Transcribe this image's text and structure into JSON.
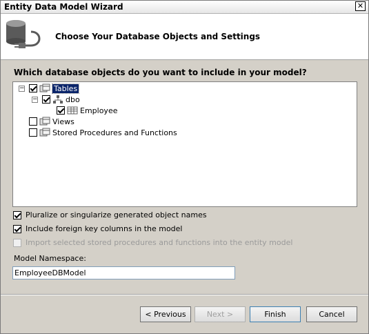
{
  "window": {
    "title": "Entity Data Model Wizard",
    "close_glyph": "✕"
  },
  "header": {
    "title": "Choose Your Database Objects and Settings"
  },
  "question": "Which database objects do you want to include in your model?",
  "tree": {
    "tables": {
      "label": "Tables",
      "checked": true,
      "expanded": true,
      "selected": true
    },
    "dbo": {
      "label": "dbo",
      "checked": true,
      "expanded": true
    },
    "employee": {
      "label": "Employee",
      "checked": true
    },
    "views": {
      "label": "Views",
      "checked": false
    },
    "procs": {
      "label": "Stored Procedures and Functions",
      "checked": false
    }
  },
  "options": {
    "pluralize": {
      "label": "Pluralize or singularize generated object names",
      "checked": true
    },
    "foreign_keys": {
      "label": "Include foreign key columns in the model",
      "checked": true
    },
    "import_procs": {
      "label": "Import selected stored procedures and functions into the entity model",
      "checked": false,
      "enabled": false
    }
  },
  "namespace": {
    "label": "Model Namespace:",
    "value": "EmployeeDBModel"
  },
  "buttons": {
    "previous": "< Previous",
    "next": "Next >",
    "finish": "Finish",
    "cancel": "Cancel"
  },
  "icons": {
    "wizard": "database-plug-icon",
    "folder": "folder-icon",
    "schema": "schema-icon",
    "table": "table-icon"
  },
  "colors": {
    "selection": "#0a246a",
    "face": "#d4d0c8"
  }
}
